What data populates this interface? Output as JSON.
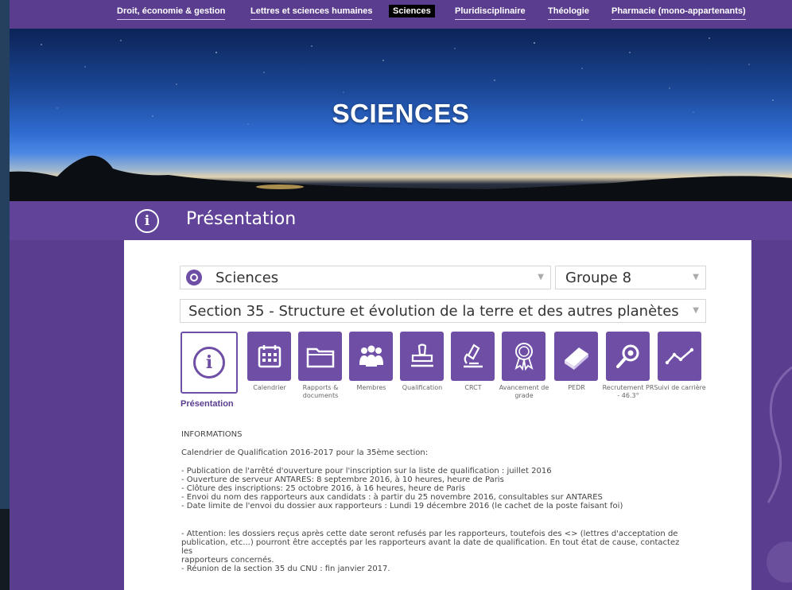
{
  "nav": {
    "items": [
      {
        "label": "Droit, économie & gestion"
      },
      {
        "label": "Lettres et sciences humaines"
      },
      {
        "label": "Sciences"
      },
      {
        "label": "Pluridisciplinaire"
      },
      {
        "label": "Théologie"
      },
      {
        "label": "Pharmacie (mono-appartenants)"
      }
    ],
    "active_index": 2
  },
  "hero": {
    "title": "SCIENCES"
  },
  "section": {
    "icon": "info-icon",
    "title": "Présentation"
  },
  "selectors": {
    "discipline": {
      "value": "Sciences",
      "icon": "globe-icon"
    },
    "groupe": {
      "value": "Groupe 8"
    },
    "section": {
      "value": "Section 35 - Structure et évolution de la terre et des autres planètes"
    }
  },
  "tiles": [
    {
      "label": "Présentation",
      "icon": "info-icon",
      "active": true
    },
    {
      "label": "Calendrier",
      "icon": "calendar-icon"
    },
    {
      "label": "Rapports & documents",
      "icon": "folder-icon"
    },
    {
      "label": "Membres",
      "icon": "people-icon"
    },
    {
      "label": "Qualification",
      "icon": "stamp-icon"
    },
    {
      "label": "CRCT",
      "icon": "microscope-icon"
    },
    {
      "label": "Avancement de grade",
      "icon": "award-icon"
    },
    {
      "label": "PEDR",
      "icon": "book-icon"
    },
    {
      "label": "Recrutement PR - 46.3°",
      "icon": "search-icon"
    },
    {
      "label": "Suivi de carrière",
      "icon": "trend-icon"
    }
  ],
  "content": {
    "heading": "INFORMATIONS",
    "intro": "Calendrier de Qualification 2016-2017 pour la 35ème section:",
    "bullets": [
      "- Publication de l'arrêté d'ouverture pour l'inscription sur la liste de qualification : juillet 2016",
      "- Ouverture de serveur ANTARES: 8 septembre 2016, à 10 heures, heure de Paris",
      "- Clôture des inscriptions: 25 octobre 2016, à 16 heures, heure de Paris",
      "- Envoi du nom des rapporteurs aux candidats : à partir du 25 novembre 2016, consultables sur ANTARES",
      "- Date limite de l'envoi du dossier aux rapporteurs : Lundi 19 décembre 2016 (le cachet de la poste faisant foi)"
    ],
    "attention": [
      "- Attention: les dossiers reçus après cette date seront refusés par les rapporteurs, toutefois des <> (lettres d'acceptation de",
      "publication, etc...) pourront être acceptés par les rapporteurs avant la date de qualification. En tout état de cause, contactez les",
      "rapporteurs concernés.",
      "- Réunion de la section 35 du CNU : fin janvier 2017."
    ]
  },
  "colors": {
    "brand": "#5a3d8f",
    "tile": "#6f4fa6"
  }
}
